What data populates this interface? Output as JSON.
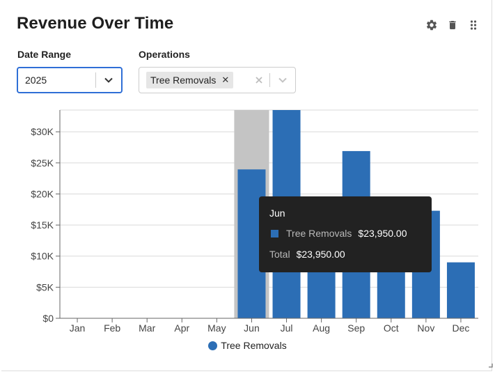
{
  "widget": {
    "title": "Revenue Over Time"
  },
  "toolbar": {
    "settings_icon": "gear-icon",
    "delete_icon": "trash-icon",
    "drag_icon": "drag-handle-icon"
  },
  "filters": {
    "date_range": {
      "label": "Date Range",
      "value": "2025"
    },
    "operations": {
      "label": "Operations",
      "selected": [
        "Tree Removals"
      ]
    }
  },
  "colors": {
    "series": "#2c6eb5",
    "hover_band": "#c4c4c4",
    "grid": "#d9d9d9",
    "accent_border": "#2f6fd6",
    "tooltip_bg": "#222222"
  },
  "chart_data": {
    "type": "bar",
    "categories": [
      "Jan",
      "Feb",
      "Mar",
      "Apr",
      "May",
      "Jun",
      "Jul",
      "Aug",
      "Sep",
      "Oct",
      "Nov",
      "Dec"
    ],
    "series": [
      {
        "name": "Tree Removals",
        "values": [
          0,
          0,
          0,
          0,
          0,
          23950,
          33500,
          13000,
          26900,
          12000,
          17300,
          9000
        ]
      }
    ],
    "ylim": [
      0,
      33500
    ],
    "yticks": [
      0,
      5000,
      10000,
      15000,
      20000,
      25000,
      30000
    ],
    "ytick_labels": [
      "$0",
      "$5K",
      "$10K",
      "$15K",
      "$20K",
      "$25K",
      "$30K"
    ],
    "grid": true,
    "legend_position": "bottom",
    "highlighted_category": "Jun"
  },
  "tooltip": {
    "title": "Jun",
    "series_name": "Tree Removals",
    "series_value": "$23,950.00",
    "total_label": "Total",
    "total_value": "$23,950.00"
  },
  "legend": {
    "label": "Tree Removals"
  }
}
